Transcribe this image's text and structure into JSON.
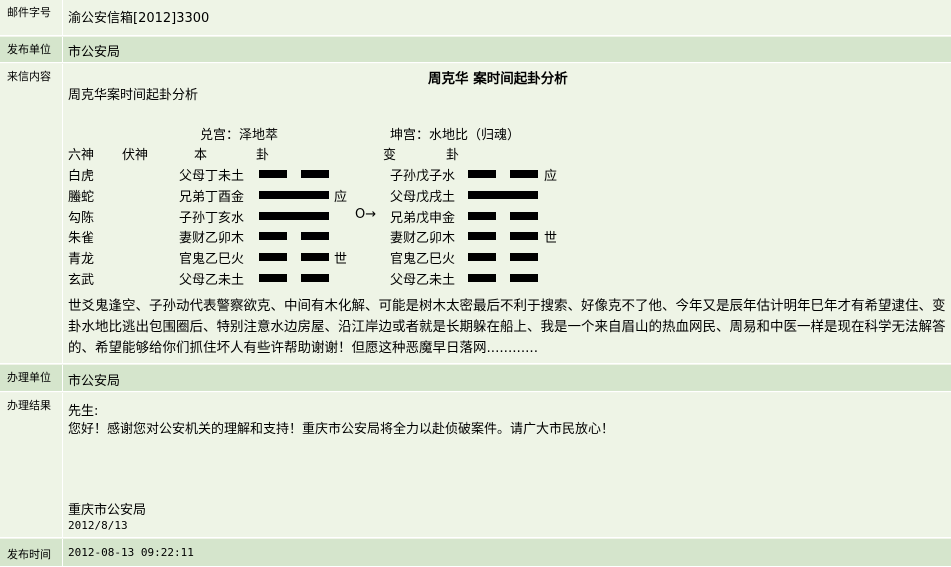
{
  "rows": {
    "post_number": {
      "label": "邮件字号",
      "value": "渝公安信箱[2012]3300"
    },
    "publisher": {
      "label": "发布单位",
      "value": "市公安局"
    },
    "letter": {
      "label": "来信内容",
      "title": "周克华 案时间起卦分析",
      "subtitle": "周克华案时间起卦分析",
      "gua_left_header": "兑宫：泽地萃",
      "gua_right_header": "坤宫：水地比（归魂）",
      "col_headers": {
        "liushen": "六神",
        "fushen": "伏神",
        "ben": "本",
        "gua1": "卦",
        "bian": "变",
        "gua2": "卦"
      },
      "lines": [
        {
          "shen": "白虎",
          "ben": "父母丁未土",
          "ben_yang": false,
          "ben_mark": "",
          "bian": "子孙戊子水",
          "bian_yang": false,
          "bian_mark": "应"
        },
        {
          "shen": "螣蛇",
          "ben": "兄弟丁酉金",
          "ben_yang": true,
          "ben_mark": "应",
          "bian": "父母戊戌土",
          "bian_yang": true,
          "bian_mark": ""
        },
        {
          "shen": "勾陈",
          "ben": "子孙丁亥水",
          "ben_yang": true,
          "ben_mark": "",
          "bian": "兄弟戊申金",
          "bian_yang": false,
          "bian_mark": ""
        },
        {
          "shen": "朱雀",
          "ben": "妻财乙卯木",
          "ben_yang": false,
          "ben_mark": "",
          "bian": "妻财乙卯木",
          "bian_yang": false,
          "bian_mark": "世"
        },
        {
          "shen": "青龙",
          "ben": "官鬼乙巳火",
          "ben_yang": false,
          "ben_mark": "世",
          "bian": "官鬼乙巳火",
          "bian_yang": false,
          "bian_mark": ""
        },
        {
          "shen": "玄武",
          "ben": "父母乙未土",
          "ben_yang": false,
          "ben_mark": "",
          "bian": "父母乙未土",
          "bian_yang": false,
          "bian_mark": ""
        }
      ],
      "moving_marker": "O→",
      "paragraph": "世爻鬼逢空、子孙动代表警察欲克、中间有木化解、可能是树木太密最后不利于搜索、好像克不了他、今年又是辰年估计明年巳年才有希望逮住、变卦水地比逃出包围圈后、特别注意水边房屋、沿江岸边或者就是长期躲在船上、我是一个来自眉山的热血网民、周易和中医一样是现在科学无法解答的、希望能够给你们抓住坏人有些许帮助谢谢！但愿这种恶魔早日落网............"
    },
    "handler": {
      "label": "办理单位",
      "value": "市公安局"
    },
    "result": {
      "label": "办理结果",
      "greeting": "先生:",
      "body": "您好！感谢您对公安机关的理解和支持！重庆市公安局将全力以赴侦破案件。请广大市民放心！",
      "signature": "重庆市公安局",
      "date": "2012/8/13"
    },
    "publish_time": {
      "label": "发布时间",
      "value": "2012-08-13 09:22:11"
    }
  }
}
